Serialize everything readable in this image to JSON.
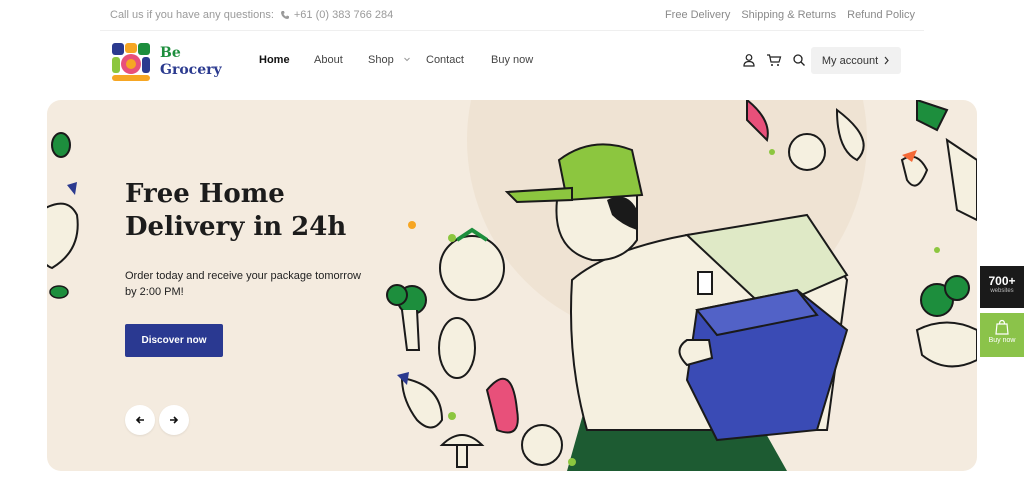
{
  "topbar": {
    "contact_label": "Call us if you have any questions:",
    "phone": "+61 (0) 383 766 284",
    "links": [
      "Free Delivery",
      "Shipping & Returns",
      "Refund Policy"
    ]
  },
  "brand": {
    "line1": "Be",
    "line2": "Grocery"
  },
  "nav": {
    "items": [
      "Home",
      "About",
      "Shop",
      "Contact",
      "Buy now"
    ]
  },
  "header": {
    "account_label": "My account",
    "icons": [
      "user-icon",
      "cart-icon",
      "search-icon",
      "chevron-right-icon"
    ]
  },
  "hero": {
    "title": "Free Home Delivery in 24h",
    "subtitle": "Order today and receive your package tomorrow by 2:00 PM!",
    "button_label": "Discover now"
  },
  "side": {
    "count": "700+",
    "count_label": "websites",
    "buy_label": "Buy now"
  },
  "colors": {
    "accent_blue": "#2a3991",
    "brand_green": "#1d8e3d",
    "hero_bg": "#f4ebdf",
    "cap_green": "#8cc63f"
  }
}
